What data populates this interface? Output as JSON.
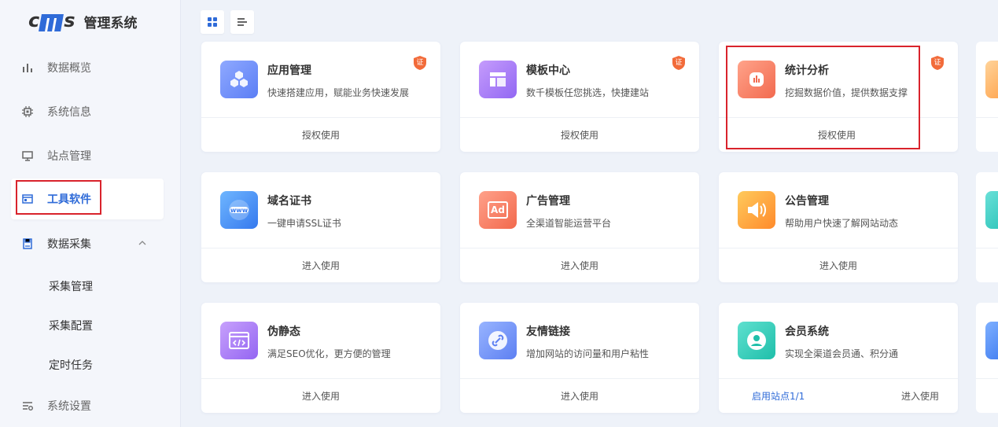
{
  "app": {
    "logo_text": "cms",
    "title": "管理系统"
  },
  "sidebar": {
    "items": [
      {
        "label": "数据概览",
        "icon": "bar-chart-icon"
      },
      {
        "label": "系统信息",
        "icon": "chip-icon"
      },
      {
        "label": "站点管理",
        "icon": "monitor-icon"
      },
      {
        "label": "工具软件",
        "icon": "window-icon",
        "active": true
      },
      {
        "label": "数据采集",
        "icon": "save-icon",
        "expanded": true
      }
    ],
    "sub_items": [
      "采集管理",
      "采集配置",
      "定时任务"
    ],
    "bottom_item": {
      "label": "系统设置",
      "icon": "sliders-icon"
    }
  },
  "toolbar": {
    "grid_view": "grid-view-icon",
    "list_view": "list-view-icon"
  },
  "cards": [
    {
      "title": "应用管理",
      "desc": "快速搭建应用，赋能业务快速发展",
      "action": "授权使用",
      "badge": "证",
      "icon": "cubes-icon"
    },
    {
      "title": "模板中心",
      "desc": "数千模板任您挑选，快捷建站",
      "action": "授权使用",
      "badge": "证",
      "icon": "layout-icon"
    },
    {
      "title": "统计分析",
      "desc": "挖掘数据价值，提供数据支撑",
      "action": "授权使用",
      "badge": "证",
      "icon": "stats-icon"
    },
    {
      "title": "域名证书",
      "desc": "一键申请SSL证书",
      "action": "进入使用",
      "icon": "www-icon",
      "icon_text": "www"
    },
    {
      "title": "广告管理",
      "desc": "全渠道智能运营平台",
      "action": "进入使用",
      "icon": "ad-icon",
      "icon_text": "Ad"
    },
    {
      "title": "公告管理",
      "desc": "帮助用户快速了解网站动态",
      "action": "进入使用",
      "icon": "speaker-icon"
    },
    {
      "title": "伪静态",
      "desc": "满足SEO优化，更方便的管理",
      "action": "进入使用",
      "icon": "code-window-icon"
    },
    {
      "title": "友情链接",
      "desc": "增加网站的访问量和用户粘性",
      "action": "进入使用",
      "icon": "link-icon"
    },
    {
      "title": "会员系统",
      "desc": "实现全渠道会员通、积分通",
      "action": "进入使用",
      "link": "启用站点1/1",
      "icon": "user-icon"
    }
  ],
  "colors": {
    "accent": "#2f6bd8",
    "highlight": "#d9232c",
    "badge": "#f26b3a"
  }
}
